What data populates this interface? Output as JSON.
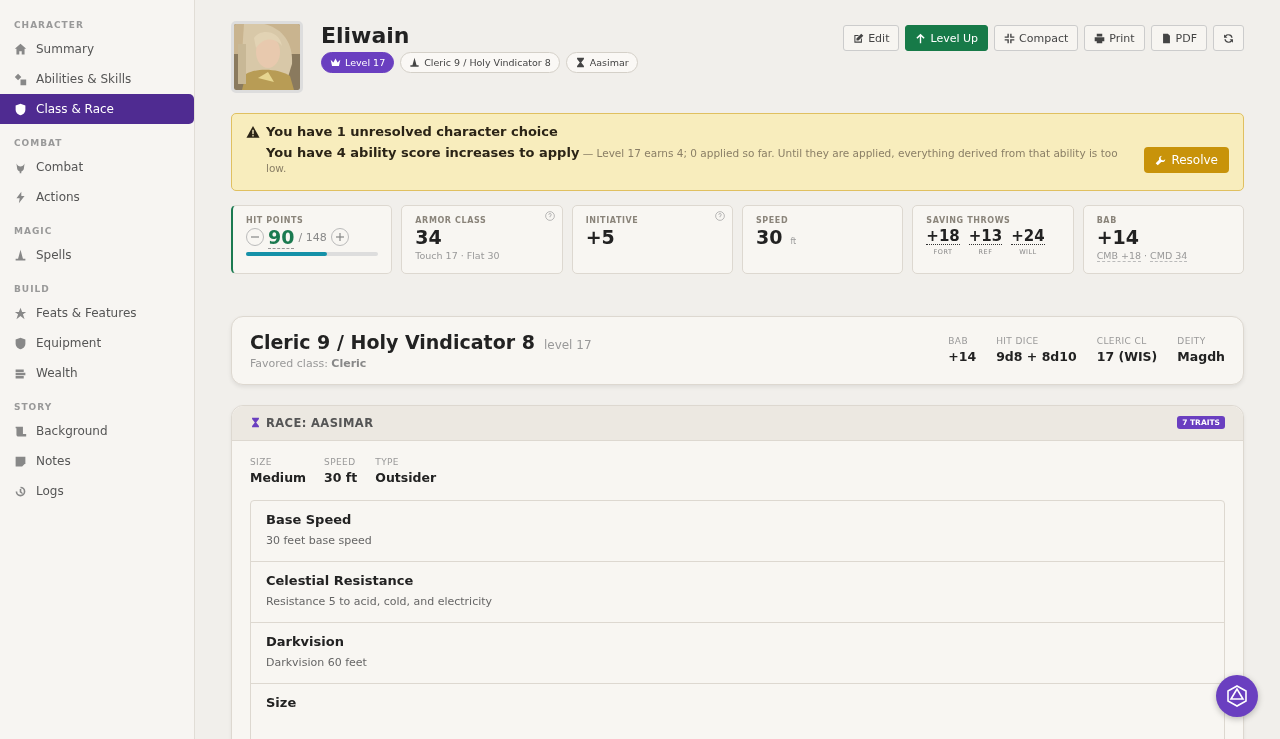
{
  "sidebar": {
    "sections": [
      {
        "title": "CHARACTER",
        "items": [
          {
            "label": "Summary",
            "selected": false
          },
          {
            "label": "Abilities & Skills",
            "selected": false
          },
          {
            "label": "Class & Race",
            "selected": true
          }
        ]
      },
      {
        "title": "COMBAT",
        "items": [
          {
            "label": "Combat",
            "selected": false
          },
          {
            "label": "Actions",
            "selected": false
          }
        ]
      },
      {
        "title": "MAGIC",
        "items": [
          {
            "label": "Spells",
            "selected": false
          }
        ]
      },
      {
        "title": "BUILD",
        "items": [
          {
            "label": "Feats & Features",
            "selected": false
          },
          {
            "label": "Equipment",
            "selected": false
          },
          {
            "label": "Wealth",
            "selected": false
          }
        ]
      },
      {
        "title": "STORY",
        "items": [
          {
            "label": "Background",
            "selected": false
          },
          {
            "label": "Notes",
            "selected": false
          },
          {
            "label": "Logs",
            "selected": false
          }
        ]
      }
    ]
  },
  "header": {
    "name": "Eliwain",
    "badges": [
      {
        "label": "Level 17",
        "kind": "level"
      },
      {
        "label": "Cleric 9 / Holy Vindicator 8",
        "kind": "class"
      },
      {
        "label": "Aasimar",
        "kind": "race"
      }
    ],
    "buttons": [
      {
        "label": "Edit",
        "kind": "edit"
      },
      {
        "label": "Level Up",
        "kind": "primary"
      },
      {
        "label": "Compact",
        "kind": "compact"
      },
      {
        "label": "Print",
        "kind": "print"
      },
      {
        "label": "PDF",
        "kind": "pdf"
      },
      {
        "kind": "refresh"
      }
    ]
  },
  "alert": {
    "title": "You have 1 unresolved character choice",
    "message": "**You have 4 ability score increases to apply** — Level 17 earns 4; 0 applied so far. Until they are applied, everything derived from that ability is too low.",
    "button": "Resolve"
  },
  "stats": [
    {
      "kind": "hp",
      "label": "HIT POINTS",
      "value": "90",
      "max": "/ 148",
      "level": 0.61
    },
    {
      "kind": "plain",
      "label": "ARMOR CLASS",
      "value": "34",
      "sub": "Touch 17 · Flat 30",
      "help": true
    },
    {
      "kind": "plain",
      "label": "INITIATIVE",
      "value": "+5",
      "help": true
    },
    {
      "kind": "plain",
      "label": "SPEED",
      "value": "30",
      "unit": "ft"
    },
    {
      "kind": "saves",
      "label": "SAVING THROWS",
      "saves": [
        {
          "value": "+18",
          "label": "FORT"
        },
        {
          "value": "+13",
          "label": "REF"
        },
        {
          "value": "+24",
          "label": "WILL"
        }
      ]
    },
    {
      "kind": "bab",
      "label": "BAB",
      "value": "+14",
      "subs": [
        "CMB +18",
        "CMD 34"
      ],
      "sep": "·"
    }
  ],
  "class_card": {
    "title": "Cleric 9 / Holy Vindicator 8",
    "level": "level 17",
    "favored_label": "Favored class:",
    "favored": "Cleric",
    "facts": [
      {
        "label": "BAB",
        "value": "+14"
      },
      {
        "label": "HIT DICE",
        "value": "9d8 + 8d10"
      },
      {
        "label": "CLERIC CL",
        "value": "17 (WIS)"
      },
      {
        "label": "DEITY",
        "value": "Magdh"
      }
    ]
  },
  "race_card": {
    "title": "RACE: AASIMAR",
    "badge": "7 TRAITS",
    "facts": [
      {
        "label": "SIZE",
        "value": "Medium"
      },
      {
        "label": "SPEED",
        "value": "30 ft"
      },
      {
        "label": "TYPE",
        "value": "Outsider"
      }
    ],
    "traits": [
      {
        "name": "Base Speed",
        "desc": "30 feet base speed"
      },
      {
        "name": "Celestial Resistance",
        "desc": "Resistance 5 to acid, cold, and electricity"
      },
      {
        "name": "Darkvision",
        "desc": "Darkvision 60 feet"
      },
      {
        "name": "Size"
      }
    ]
  }
}
